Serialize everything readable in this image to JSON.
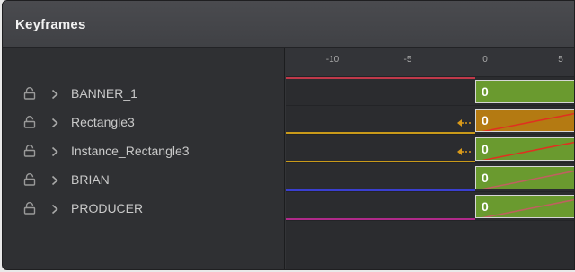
{
  "panel": {
    "title": "Keyframes"
  },
  "ruler": {
    "ticks": [
      "-10",
      "-5",
      "0",
      "5"
    ]
  },
  "tracks": [
    {
      "label": "BANNER_1",
      "line_color": "#c0394a",
      "block_color": "#6a9a2f",
      "keyframe_value": "0",
      "has_arrow": false,
      "curve_color": ""
    },
    {
      "label": "Rectangle3",
      "line_color": "#c99a1a",
      "block_color": "#b47a12",
      "keyframe_value": "0",
      "has_arrow": true,
      "curve_color": "#e03020"
    },
    {
      "label": "Instance_Rectangle3",
      "line_color": "#c99a1a",
      "block_color": "#6a9a2f",
      "keyframe_value": "0",
      "has_arrow": true,
      "curve_color": "#e03020"
    },
    {
      "label": "BRIAN",
      "line_color": "#3a3fd0",
      "block_color": "#6a9a2f",
      "keyframe_value": "0",
      "has_arrow": false,
      "curve_color": "#c06060"
    },
    {
      "label": "PRODUCER",
      "line_color": "#b02a8a",
      "block_color": "#6a9a2f",
      "keyframe_value": "0",
      "has_arrow": false,
      "curve_color": "#c06060"
    }
  ],
  "colors": {
    "arrow": "#d99a1a"
  },
  "icons": {
    "lock": "lock-icon",
    "expand": "chevron-right-icon",
    "arrow": "keyframe-arrow-icon"
  }
}
